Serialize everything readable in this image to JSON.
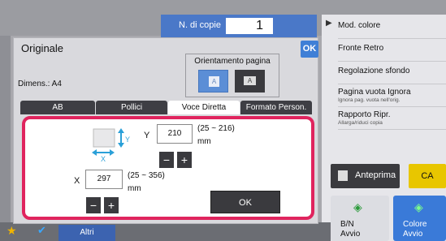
{
  "copies": {
    "label": "N. di copie",
    "value": "1"
  },
  "dialog": {
    "title": "Originale",
    "ok_top": "OK",
    "dimens": "Dimens.: A4",
    "orientation": {
      "label": "Orientamento pagina",
      "option_a": "A",
      "option_b": "A"
    },
    "tabs": [
      "AB",
      "Pollici",
      "Voce Diretta",
      "Formato Person."
    ],
    "active_tab": "Voce Diretta",
    "y": {
      "label": "Y",
      "value": "210",
      "range": "(25 ~ 216)",
      "unit": "mm"
    },
    "x": {
      "label": "X",
      "value": "297",
      "range": "(25 ~ 356)",
      "unit": "mm"
    },
    "minus": "−",
    "plus": "+",
    "ok": "OK"
  },
  "right_panel": {
    "items": [
      {
        "label": "Mod. colore",
        "sub": ""
      },
      {
        "label": "Fronte Retro",
        "sub": ""
      },
      {
        "label": "Regolazione sfondo",
        "sub": ""
      },
      {
        "label": "Pagina vuota Ignora",
        "sub": "Ignora pag. vuota nell'orig."
      },
      {
        "label": "Rapporto Ripr.",
        "sub": "Allarga/riduci copia"
      }
    ],
    "anteprima": "Anteprima",
    "ca": "CA",
    "bn": {
      "line1": "B/N",
      "line2": "Avvio"
    },
    "colore": {
      "line1": "Colore",
      "line2": "Avvio"
    }
  },
  "bottom": {
    "altri": "Altri"
  },
  "colors": {
    "accent": "#3f7fd6",
    "highlight_border": "#e0245e",
    "ca": "#e8c600"
  }
}
